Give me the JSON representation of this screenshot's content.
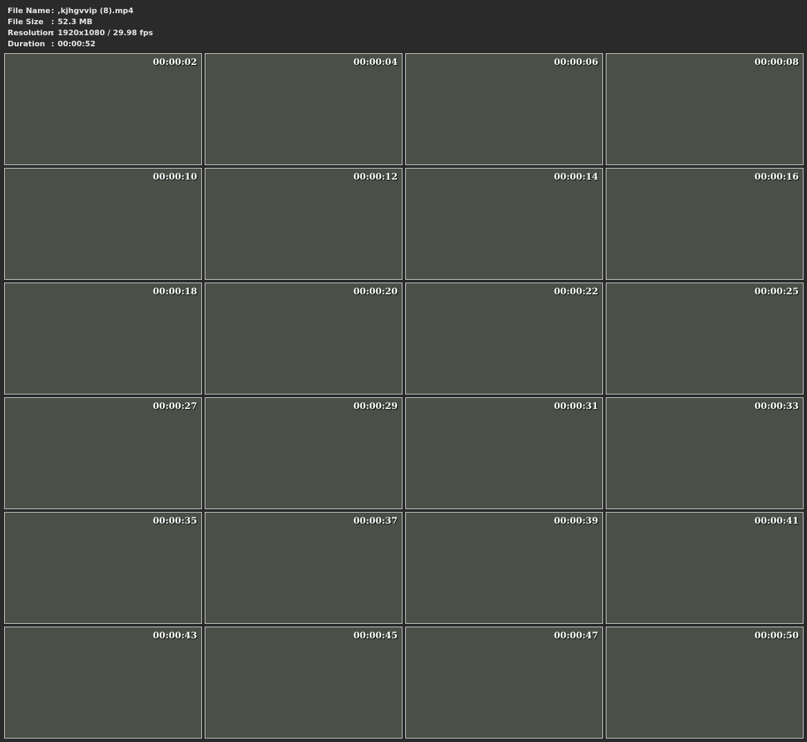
{
  "info": [
    {
      "label": "File Name",
      "value": ",kjhgvvip (8).mp4"
    },
    {
      "label": "File Size",
      "value": "52.3 MB"
    },
    {
      "label": "Resolution",
      "value": "1920x1080 / 29.98 fps"
    },
    {
      "label": "Duration",
      "value": "00:00:52"
    }
  ],
  "separator": ":",
  "thumbnails": [
    "00:00:02",
    "00:00:04",
    "00:00:06",
    "00:00:08",
    "00:00:10",
    "00:00:12",
    "00:00:14",
    "00:00:16",
    "00:00:18",
    "00:00:20",
    "00:00:22",
    "00:00:25",
    "00:00:27",
    "00:00:29",
    "00:00:31",
    "00:00:33",
    "00:00:35",
    "00:00:37",
    "00:00:39",
    "00:00:41",
    "00:00:43",
    "00:00:45",
    "00:00:47",
    "00:00:50"
  ]
}
